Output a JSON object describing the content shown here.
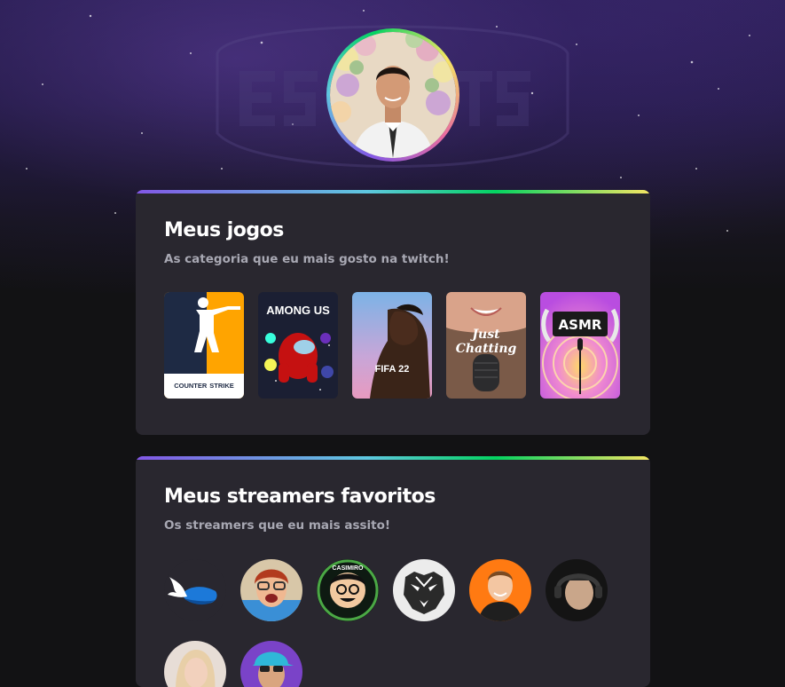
{
  "profile": {
    "avatar_alt": "profile-photo"
  },
  "games_section": {
    "title": "Meus jogos",
    "subtitle": "As categoria que eu mais gosto na twitch!",
    "items": [
      {
        "name": "Counter Strike",
        "label_line1": "COUNTER",
        "label_line2": "STRIKE"
      },
      {
        "name": "Among Us",
        "label": "AMONG US"
      },
      {
        "name": "FIFA 22",
        "label": "FIFA 22"
      },
      {
        "name": "Just Chatting",
        "label_line1": "Just",
        "label_line2": "Chatting"
      },
      {
        "name": "ASMR",
        "label": "ASMR"
      }
    ]
  },
  "streamers_section": {
    "title": "Meus streamers favoritos",
    "subtitle": "Os streamers que eu mais assito!",
    "badge_text": "CASIMIRO"
  }
}
